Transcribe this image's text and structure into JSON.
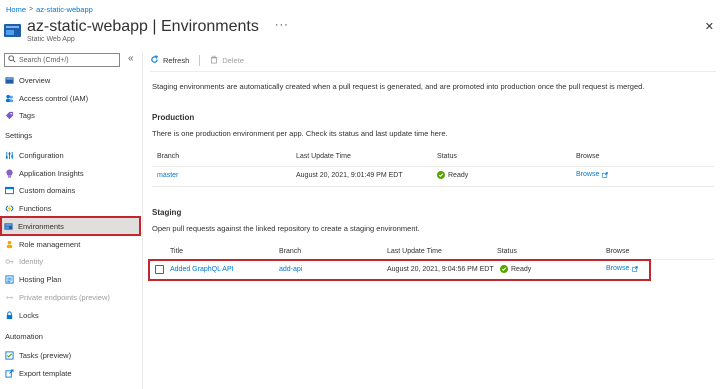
{
  "breadcrumb": {
    "home": "Home",
    "separator": ">",
    "resource": "az-static-webapp"
  },
  "header": {
    "title": "az-static-webapp | Environments",
    "subtitle": "Static Web App",
    "more": "···",
    "close": "✕"
  },
  "sidebar": {
    "search_placeholder": "Search (Cmd+/)",
    "collapse": "«",
    "top_items": [
      {
        "label": "Overview",
        "icon": "globe-icon"
      },
      {
        "label": "Access control (IAM)",
        "icon": "people-icon"
      },
      {
        "label": "Tags",
        "icon": "tag-icon"
      }
    ],
    "settings_title": "Settings",
    "settings_items": [
      {
        "label": "Configuration",
        "icon": "sliders-icon",
        "disabled": false
      },
      {
        "label": "Application Insights",
        "icon": "lightbulb-icon",
        "disabled": false
      },
      {
        "label": "Custom domains",
        "icon": "domain-icon",
        "disabled": false
      },
      {
        "label": "Functions",
        "icon": "function-icon",
        "disabled": false
      },
      {
        "label": "Environments",
        "icon": "environments-icon",
        "disabled": false,
        "active": true
      },
      {
        "label": "Role management",
        "icon": "person-icon",
        "disabled": false
      },
      {
        "label": "Identity",
        "icon": "key-icon",
        "disabled": true
      },
      {
        "label": "Hosting Plan",
        "icon": "plan-icon",
        "disabled": false
      },
      {
        "label": "Private endpoints (preview)",
        "icon": "endpoint-icon",
        "disabled": true
      },
      {
        "label": "Locks",
        "icon": "lock-icon",
        "disabled": false
      }
    ],
    "automation_title": "Automation",
    "automation_items": [
      {
        "label": "Tasks (preview)",
        "icon": "tasks-icon"
      },
      {
        "label": "Export template",
        "icon": "export-icon"
      }
    ]
  },
  "toolbar": {
    "refresh": "Refresh",
    "delete": "Delete"
  },
  "main": {
    "description": "Staging environments are automatically created when a pull request is generated, and are promoted into production once the pull request is merged.",
    "production": {
      "heading": "Production",
      "text": "There is one production environment per app. Check its status and last update time here.",
      "columns": [
        "Branch",
        "Last Update Time",
        "Status",
        "Browse"
      ],
      "row": {
        "branch": "master",
        "last_update": "August 20, 2021, 9:01:49 PM EDT",
        "status": "Ready",
        "browse": "Browse"
      }
    },
    "staging": {
      "heading": "Staging",
      "text": "Open pull requests against the linked repository to create a staging environment.",
      "columns": [
        "Title",
        "Branch",
        "Last Update Time",
        "Status",
        "Browse"
      ],
      "row": {
        "title": "Added GraphQL API",
        "branch": "add-api",
        "last_update": "August 20, 2021, 9:04:56 PM EDT",
        "status": "Ready",
        "browse": "Browse"
      }
    }
  },
  "colors": {
    "link": "#0078d4",
    "highlight": "#c4262e",
    "ready": "#57a300"
  }
}
